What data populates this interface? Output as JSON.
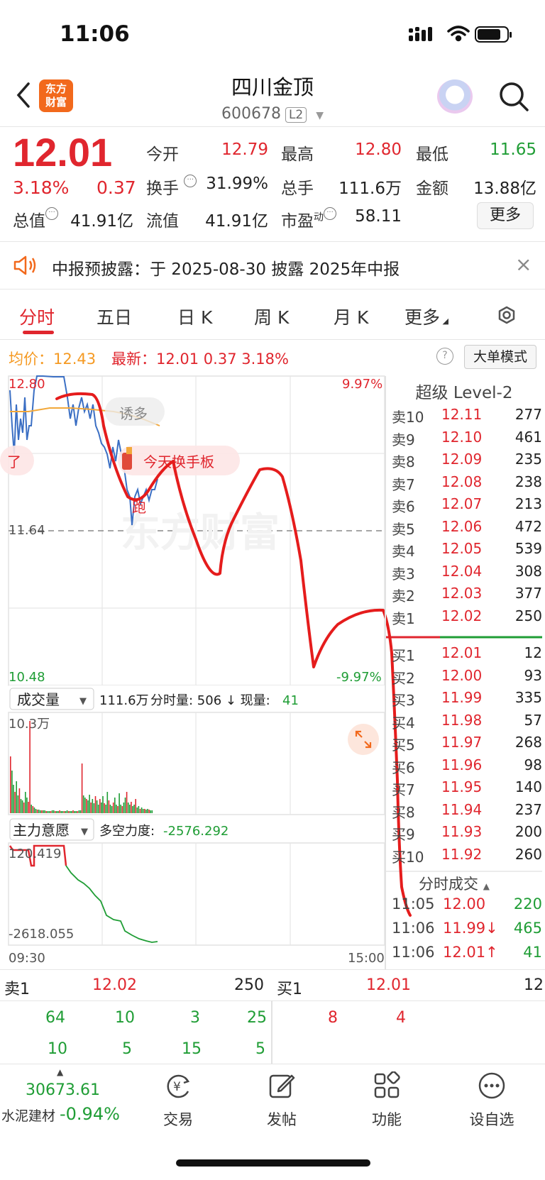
{
  "status": {
    "time": "11:06"
  },
  "nav": {
    "logo_line1": "东方",
    "logo_line2": "财富",
    "title": "四川金顶",
    "code": "600678",
    "level": "L2"
  },
  "quote": {
    "price": "12.01",
    "pct": "3.18%",
    "chg": "0.37",
    "open_label": "今开",
    "open": "12.79",
    "high_label": "最高",
    "high": "12.80",
    "low_label": "最低",
    "low": "11.65",
    "turnover_label": "换手",
    "turnover": "31.99%",
    "volume_label": "总手",
    "volume": "111.6万",
    "amount_label": "金额",
    "amount": "13.88亿",
    "mcap_label": "总值",
    "mcap": "41.91亿",
    "float_label": "流值",
    "float": "41.91亿",
    "pe_label": "市盈",
    "pe_sup": "动",
    "pe": "58.11",
    "more": "更多"
  },
  "notice": {
    "text": "中报预披露：于 2025-08-30 披露 2025年中报",
    "close": "×"
  },
  "tabs": [
    "分时",
    "五日",
    "日 K",
    "周 K",
    "月 K",
    "更多"
  ],
  "info": {
    "avg_label": "均价：12.43",
    "latest_label": "最新：12.01  0.37  3.18%",
    "help": "?",
    "mode": "大单模式"
  },
  "chart": {
    "top_left": "12.80",
    "top_right": "9.97%",
    "mid": "11.64",
    "bottom_left": "10.48",
    "bottom_right": "-9.97%",
    "tag1": "诱多",
    "tag2": "今天换手板",
    "tag_left": "了",
    "tag3": "跑",
    "vol_header": "成交量",
    "vol_total": "111.6万",
    "vol_fenshi": "分时量: 506 ↓ 现量:",
    "vol_now": "41",
    "vol_max": "10.3万",
    "flow_header": "主力意愿",
    "flow_label": "多空力度:",
    "flow_value": "-2576.292",
    "flow_top": "120.419",
    "flow_bottom": "-2618.055",
    "time_start": "09:30",
    "time_end": "15:00",
    "watermark": "东方财富"
  },
  "orderbook": {
    "title": "超级 Level-2",
    "asks": [
      {
        "label": "卖10",
        "price": "12.11",
        "vol": "277",
        "dot": "#2f5bd6"
      },
      {
        "label": "卖9",
        "price": "12.10",
        "vol": "461",
        "dot": "#dddddd"
      },
      {
        "label": "卖8",
        "price": "12.09",
        "vol": "235",
        "dot": "#dddddd"
      },
      {
        "label": "卖7",
        "price": "12.08",
        "vol": "238",
        "dot": "#dddddd"
      },
      {
        "label": "卖6",
        "price": "12.07",
        "vol": "213",
        "dot": "#dddddd"
      },
      {
        "label": "卖5",
        "price": "12.06",
        "vol": "472",
        "dot": "#dddddd"
      },
      {
        "label": "卖4",
        "price": "12.05",
        "vol": "539",
        "dot": "#dddddd"
      },
      {
        "label": "卖3",
        "price": "12.04",
        "vol": "308",
        "dot": "#dddddd"
      },
      {
        "label": "卖2",
        "price": "12.03",
        "vol": "377",
        "dot": "#2f5bd6"
      },
      {
        "label": "卖1",
        "price": "12.02",
        "vol": "250",
        "dot": "#dddddd"
      }
    ],
    "bids": [
      {
        "label": "买1",
        "price": "12.01",
        "vol": "12",
        "dot": "#dddddd"
      },
      {
        "label": "买2",
        "price": "12.00",
        "vol": "93",
        "dot": "#dddddd"
      },
      {
        "label": "买3",
        "price": "11.99",
        "vol": "335",
        "dot": "#dddddd"
      },
      {
        "label": "买4",
        "price": "11.98",
        "vol": "57",
        "dot": "#dddddd"
      },
      {
        "label": "买5",
        "price": "11.97",
        "vol": "268",
        "dot": "#dddddd"
      },
      {
        "label": "买6",
        "price": "11.96",
        "vol": "98",
        "dot": "#dddddd"
      },
      {
        "label": "买7",
        "price": "11.95",
        "vol": "140",
        "dot": "#dddddd"
      },
      {
        "label": "买8",
        "price": "11.94",
        "vol": "237",
        "dot": "#dddddd"
      },
      {
        "label": "买9",
        "price": "11.93",
        "vol": "200",
        "dot": "#dddddd"
      },
      {
        "label": "买10",
        "price": "11.92",
        "vol": "260",
        "dot": "#ef6a1a"
      }
    ],
    "trades_title": "分时成交",
    "trades": [
      {
        "time": "11:05",
        "price": "12.00",
        "vol": "220",
        "color": "#e0262e",
        "volcolor": "#1f9d35"
      },
      {
        "time": "11:06",
        "price": "11.99↓",
        "vol": "465",
        "color": "#e0262e",
        "volcolor": "#1f9d35"
      },
      {
        "time": "11:06",
        "price": "12.01↑",
        "vol": "41",
        "color": "#e0262e",
        "volcolor": "#1f9d35"
      }
    ]
  },
  "level1": {
    "sell_label": "卖1",
    "sell_price": "12.02",
    "sell_vol": "250",
    "buy_label": "买1",
    "buy_price": "12.01",
    "buy_vol": "12",
    "sell_queue_row1": [
      "64",
      "10",
      "3",
      "25"
    ],
    "sell_queue_row2": [
      "10",
      "5",
      "15",
      "5"
    ],
    "buy_queue_row1": [
      "8",
      "4"
    ]
  },
  "bottom": {
    "index_value": "30673.61",
    "index_name": "水泥建材",
    "index_change": "-0.94%",
    "items": [
      {
        "label": "交易",
        "icon": "yen-cycle-icon"
      },
      {
        "label": "发帖",
        "icon": "edit-icon"
      },
      {
        "label": "功能",
        "icon": "grid-icon"
      },
      {
        "label": "设自选",
        "icon": "more-icon"
      }
    ]
  }
}
